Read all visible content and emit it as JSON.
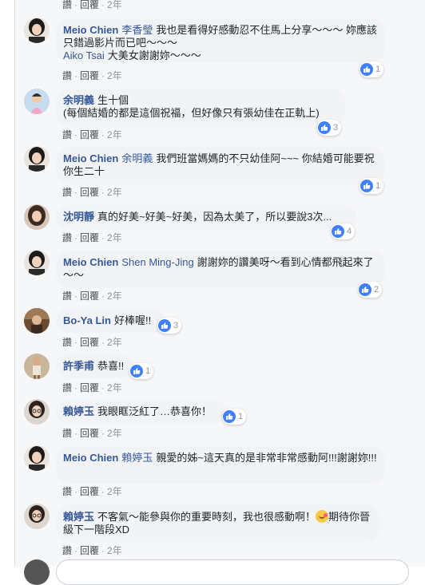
{
  "labels": {
    "like": "讚",
    "reply": "回覆",
    "dot": "·",
    "age": "2年"
  },
  "colors": {
    "author": "#365899",
    "bubble": "#f2f3f5",
    "meta": "#90949c",
    "like": "#4080ff"
  },
  "comments": [
    {
      "author": "Meio Chien",
      "tag": "李香瑩",
      "text": "我也是看得好感動忍不住馬上分享～～～ 妳應該只錯過影片而已吧～～～",
      "tag2": "Aiko Tsai",
      "text2": "大美女謝謝妳～～～",
      "likes": "1"
    },
    {
      "author": "余明義",
      "text": "生十個",
      "text2": "(每個結婚的都是這個祝福，但好像只有張幼佳在正軌上)",
      "likes": "3"
    },
    {
      "author": "Meio Chien",
      "tag": "余明義",
      "text": "我們班當媽媽的不只幼佳阿~~~ 你結婚可能要祝你生二十",
      "likes": "1"
    },
    {
      "author": "沈明靜",
      "text": "真的好美~好美~好美，因為太美了，所以要說3次...",
      "likes": "4"
    },
    {
      "author": "Meio Chien",
      "tag": "Shen Ming-Jing",
      "text": "謝謝妳的讚美呀～看到心情都飛起來了～～",
      "likes": "2"
    },
    {
      "author": "Bo-Ya Lin",
      "text": "好棒喔!!",
      "likes": "3"
    },
    {
      "author": "許季甫",
      "text": "恭喜!!",
      "likes": "1"
    },
    {
      "author": "賴婷玉",
      "text": "我眼眶泛紅了…恭喜你！",
      "likes": "1"
    },
    {
      "author": "Meio Chien",
      "tag": "賴婷玉",
      "text": "親愛的姊~這天真的是非常非常感動阿!!!謝謝妳!!!"
    },
    {
      "author": "賴婷玉",
      "text": "不客氣～能參與你的重要時刻，我也很感動啊！",
      "emoji": "blush-kiss-emoji",
      "text2": "期待你晉級下一階段XD"
    }
  ]
}
